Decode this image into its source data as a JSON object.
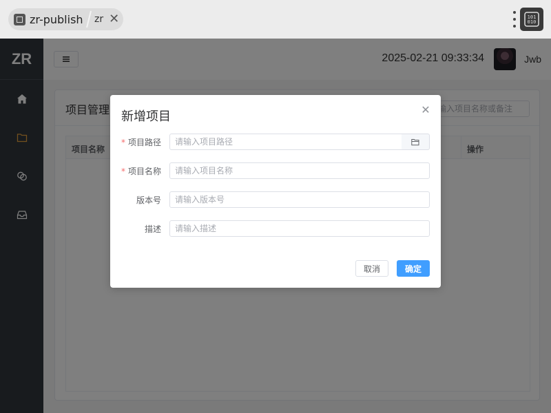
{
  "browser": {
    "tab_title": "zr-publish",
    "sub_tab_label": "zr",
    "icons": {
      "favicon": "app-favicon-icon",
      "close": "close-icon",
      "menu": "more-vertical-icon",
      "extension": "binary-icon"
    }
  },
  "app": {
    "logo": "ZR",
    "sidebar": {
      "items": [
        {
          "icon": "home-icon",
          "active": false
        },
        {
          "icon": "folder-icon",
          "active": true
        },
        {
          "icon": "link-icon",
          "active": false
        },
        {
          "icon": "inbox-icon",
          "active": false
        }
      ],
      "active_color": "#e6a23c"
    },
    "header": {
      "datetime": "2025-02-21 09:33:34",
      "username": "Jwb"
    },
    "card": {
      "title": "项目管理",
      "search_placeholder": "输入项目名称或备注"
    },
    "table": {
      "columns": [
        "项目名称",
        "操作"
      ]
    }
  },
  "dialog": {
    "title": "新增项目",
    "fields": [
      {
        "label": "项目路径",
        "required": true,
        "placeholder": "请输入项目路径",
        "has_folder_button": true
      },
      {
        "label": "项目名称",
        "required": true,
        "placeholder": "请输入项目名称"
      },
      {
        "label": "版本号",
        "required": false,
        "placeholder": "请输入版本号"
      },
      {
        "label": "描述",
        "required": false,
        "placeholder": "请输入描述"
      }
    ],
    "required_mark": "*",
    "cancel_label": "取消",
    "confirm_label": "确定",
    "accent": "#409eff"
  }
}
